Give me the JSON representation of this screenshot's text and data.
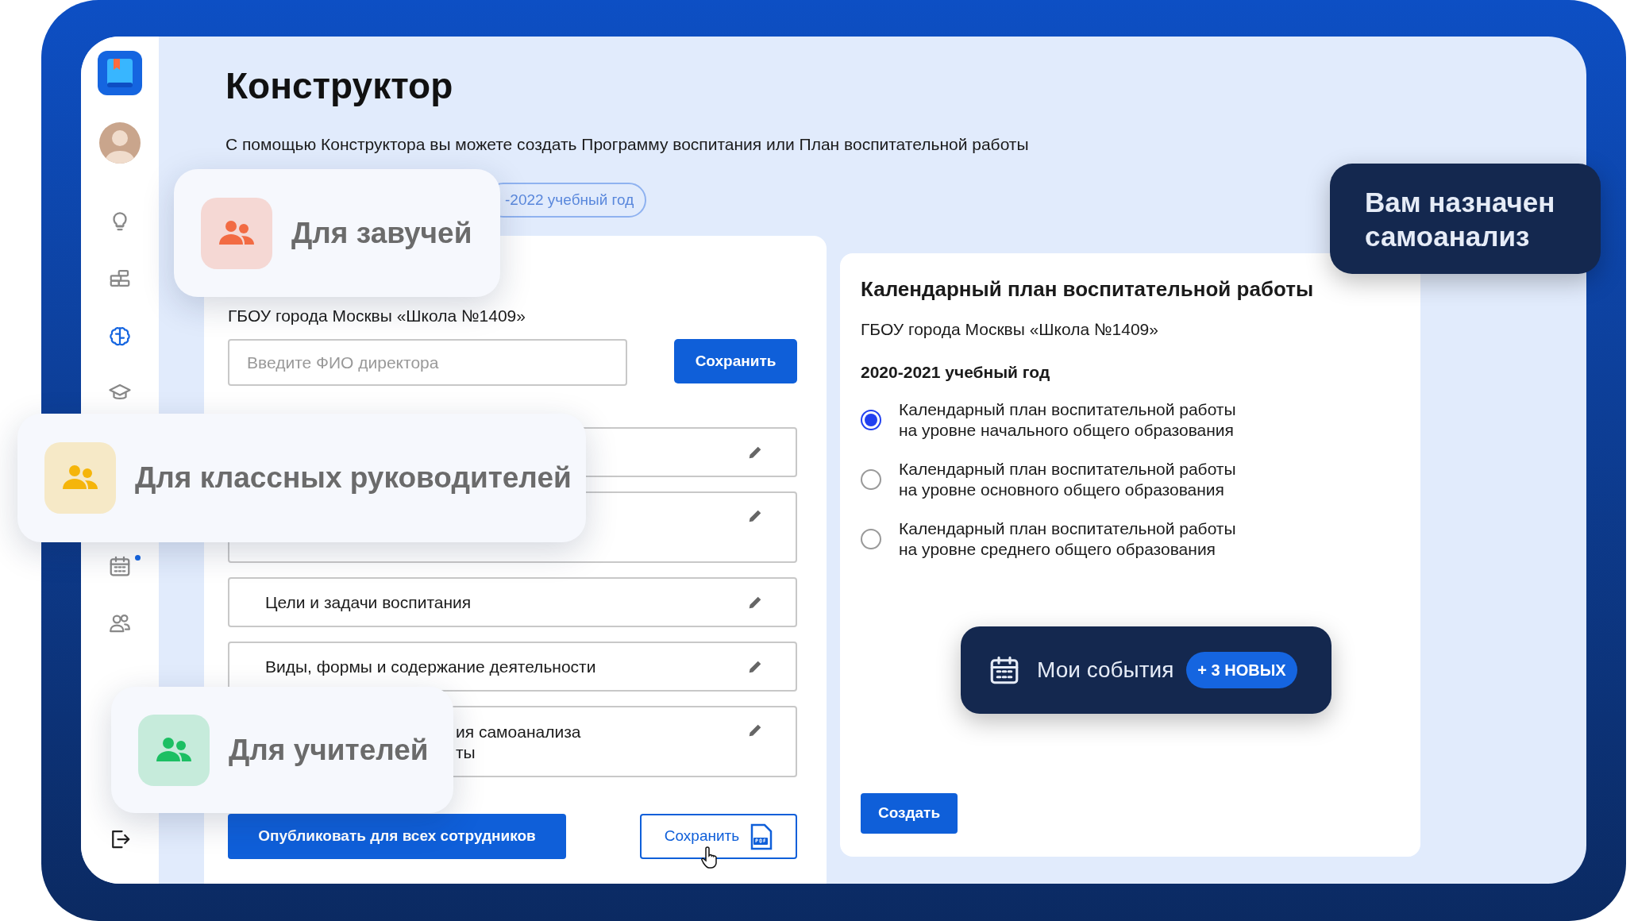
{
  "sidebar": {
    "items": [
      {
        "kind": "bulb",
        "selected": false
      },
      {
        "kind": "bricks",
        "selected": false
      },
      {
        "kind": "brain",
        "selected": true
      },
      {
        "kind": "cap",
        "selected": false
      },
      {
        "kind": "calendar",
        "selected": false,
        "badge": true
      },
      {
        "kind": "people",
        "selected": false
      }
    ]
  },
  "page": {
    "title": "Конструктор",
    "description": "С помощью Конструктора вы можете создать Программу воспитания или План воспитательной работы",
    "year_pill": "-2022 учебный год"
  },
  "left_card": {
    "school": "ГБОУ города Москвы «Школа №1409»",
    "director_field": {
      "placeholder": "Введите ФИО директора"
    },
    "save_button": "Сохранить",
    "sections": [
      {
        "tall": false
      },
      {
        "tall": true
      },
      {
        "lines": [
          "Цели и задачи воспитания"
        ],
        "tall": false
      },
      {
        "lines": [
          "Виды, формы и содержание деятельности"
        ],
        "tall": false
      },
      {
        "lines": [
          "ия самоанализа",
          "ты"
        ],
        "tall": true
      }
    ],
    "publish_button": "Опубликовать для всех сотрудников",
    "save_pdf_button": "Сохранить"
  },
  "right_card": {
    "title": "Календарный план воспитательной работы",
    "school": "ГБОУ города Москвы «Школа №1409»",
    "year": "2020-2021 учебный год",
    "options": [
      {
        "lines": [
          "Календарный план воспитательной работы",
          "на уровне начального общего образования"
        ],
        "selected": true
      },
      {
        "lines": [
          "Календарный план воспитательной работы",
          "на уровне основного общего образования"
        ],
        "selected": false
      },
      {
        "lines": [
          "Календарный план воспитательной работы",
          "на уровне среднего общего образования"
        ],
        "selected": false
      }
    ],
    "create_button": "Создать"
  },
  "notification": {
    "text": "Вам назначен самоанализ"
  },
  "events": {
    "label": "Мои события",
    "badge": "+ 3 НОВЫХ"
  },
  "audience_cards": [
    {
      "label": "Для завучей",
      "color": "#f26b43"
    },
    {
      "label": "Для классных руководителей",
      "color": "#f5b50a"
    },
    {
      "label": "Для учителей",
      "color": "#1cbf63"
    }
  ]
}
